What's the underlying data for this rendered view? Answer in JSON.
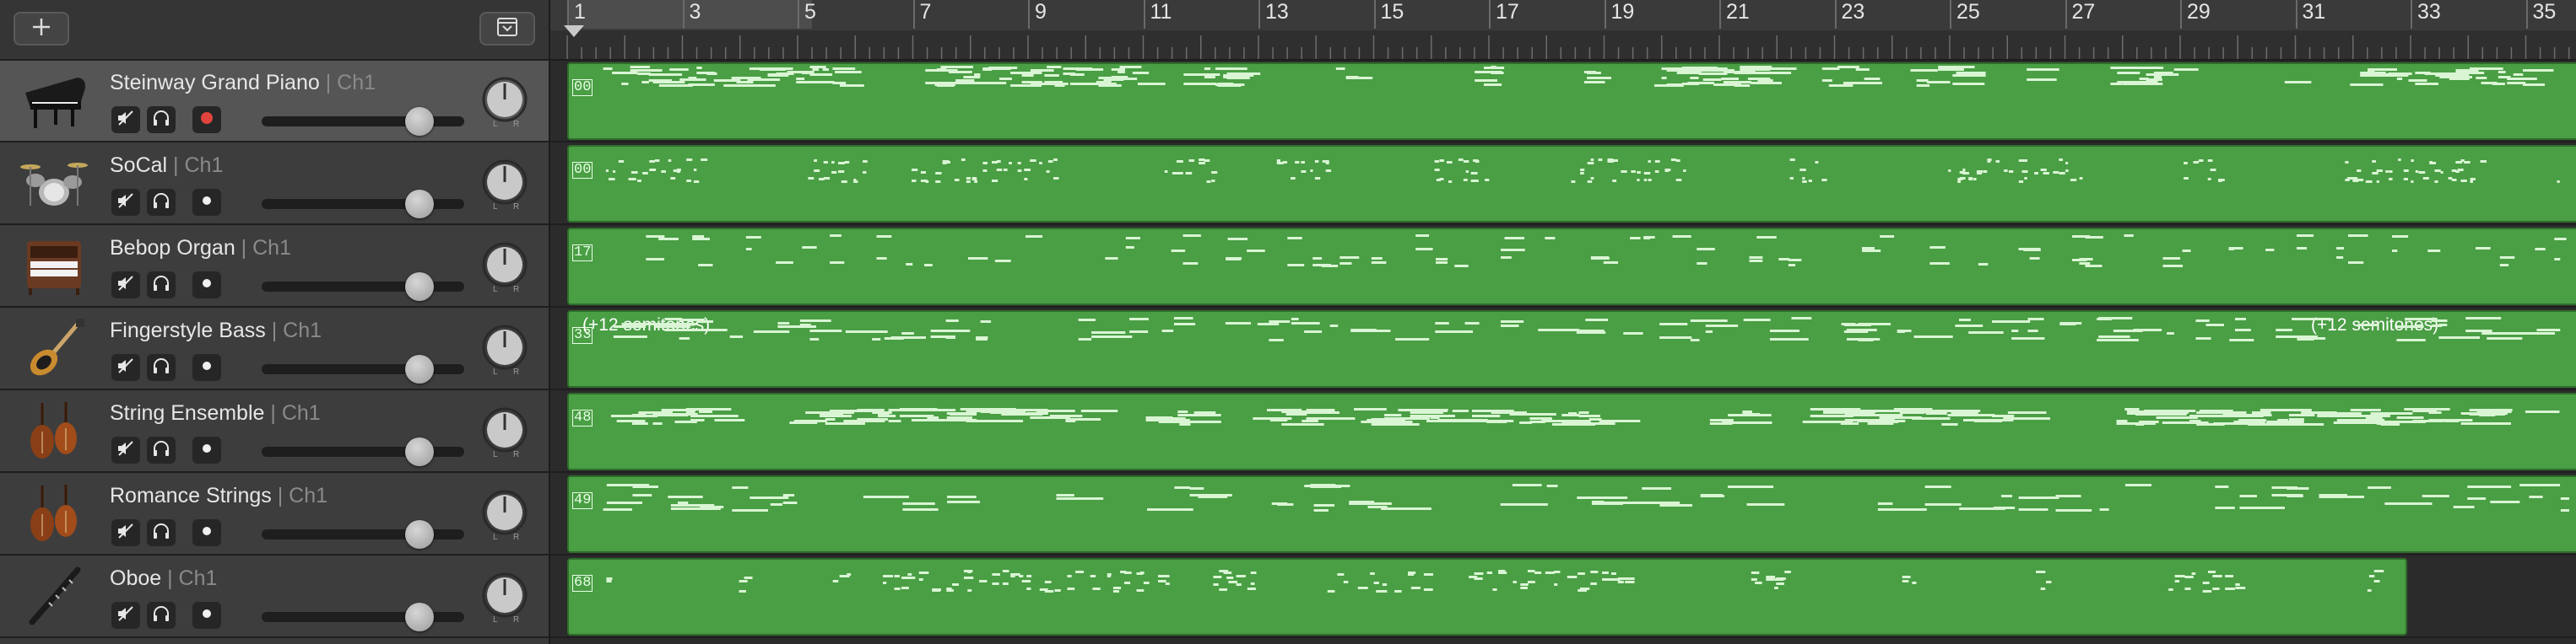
{
  "toolbar": {
    "add_track_icon": "plus-icon",
    "library_icon": "chevron-down-box-icon"
  },
  "ruler": {
    "bars": [
      "1",
      "3",
      "5",
      "7",
      "9",
      "11",
      "13",
      "15",
      "17",
      "19",
      "21",
      "23",
      "25",
      "27",
      "29",
      "31",
      "33",
      "35"
    ]
  },
  "tracks": [
    {
      "name": "Steinway Grand Piano",
      "channel": "| Ch1",
      "instrument_icon": "grand-piano-icon",
      "record_armed": true,
      "volume": 0.78,
      "region_number": "00",
      "region_label_left": "",
      "region_label_right": ""
    },
    {
      "name": "SoCal",
      "channel": "| Ch1",
      "instrument_icon": "drum-kit-icon",
      "record_armed": false,
      "volume": 0.78,
      "region_number": "00",
      "region_label_left": "",
      "region_label_right": ""
    },
    {
      "name": "Bebop Organ",
      "channel": "| Ch1",
      "instrument_icon": "organ-icon",
      "record_armed": false,
      "volume": 0.78,
      "region_number": "17",
      "region_label_left": "",
      "region_label_right": ""
    },
    {
      "name": "Fingerstyle Bass",
      "channel": "| Ch1",
      "instrument_icon": "bass-guitar-icon",
      "record_armed": false,
      "volume": 0.78,
      "region_number": "33",
      "region_label_left": "(+12 semitones)",
      "region_label_right": "(+12 semitones)"
    },
    {
      "name": "String Ensemble",
      "channel": "| Ch1",
      "instrument_icon": "violins-icon",
      "record_armed": false,
      "volume": 0.78,
      "region_number": "48",
      "region_label_left": "",
      "region_label_right": ""
    },
    {
      "name": "Romance Strings",
      "channel": "| Ch1",
      "instrument_icon": "violins-icon",
      "record_armed": false,
      "volume": 0.78,
      "region_number": "49",
      "region_label_left": "",
      "region_label_right": ""
    },
    {
      "name": "Oboe",
      "channel": "| Ch1",
      "instrument_icon": "oboe-icon",
      "record_armed": false,
      "volume": 0.78,
      "region_number": "68",
      "region_label_left": "",
      "region_label_right": ""
    }
  ],
  "colors": {
    "region_green": "#4a9e44",
    "note_color": "#d9f5d4",
    "record_red": "#e0443c",
    "selected_header": "#555555"
  }
}
